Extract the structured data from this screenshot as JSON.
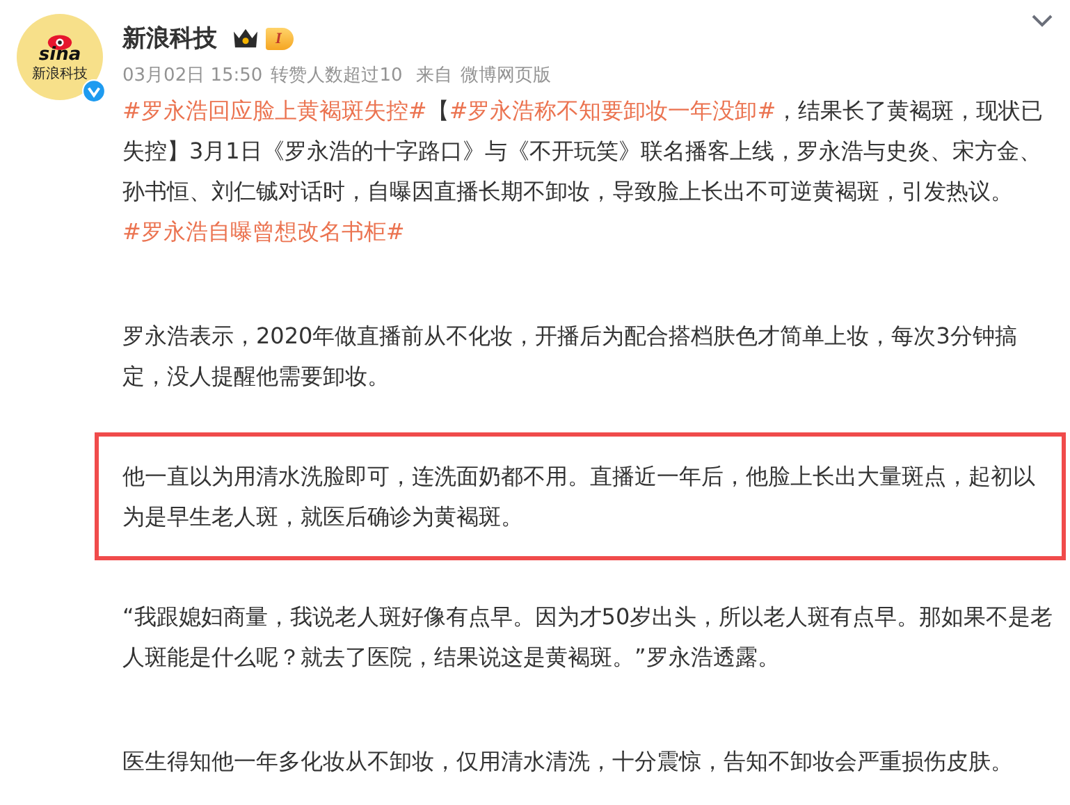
{
  "post": {
    "avatar": {
      "logo": "sina",
      "caption": "新浪科技",
      "verified": true
    },
    "author": "新浪科技",
    "level": "I",
    "meta": {
      "time": "03月02日 15:50",
      "stat": "转赞人数超过10",
      "source_label": "来自",
      "source": "微博网页版"
    },
    "paragraphs": [
      {
        "highlighted": false,
        "segments": [
          {
            "kind": "hashtag",
            "text": "#罗永浩回应脸上黄褐斑失控#"
          },
          {
            "kind": "text",
            "text": "【"
          },
          {
            "kind": "hashtag",
            "text": "#罗永浩称不知要卸妆一年没卸#"
          },
          {
            "kind": "text",
            "text": "，结果长了黄褐斑，现状已失控】3月1日《罗永浩的十字路口》与《不开玩笑》联名播客上线，罗永浩与史炎、宋方金、孙书恒、刘仁铖对话时，自曝因直播长期不卸妆，导致脸上长出不可逆黄褐斑，引发热议。"
          },
          {
            "kind": "hashtag",
            "text": "#罗永浩自曝曾想改名书柜#"
          }
        ]
      },
      {
        "highlighted": false,
        "segments": [
          {
            "kind": "text",
            "text": "罗永浩表示，2020年做直播前从不化妆，开播后为配合搭档肤色才简单上妆，每次3分钟搞定，没人提醒他需要卸妆。"
          }
        ]
      },
      {
        "highlighted": true,
        "segments": [
          {
            "kind": "text",
            "text": "他一直以为用清水洗脸即可，连洗面奶都不用。直播近一年后，他脸上长出大量斑点，起初以为是早生老人斑，就医后确诊为黄褐斑。"
          }
        ]
      },
      {
        "highlighted": false,
        "segments": [
          {
            "kind": "text",
            "text": "“我跟媳妇商量，我说老人斑好像有点早。因为才50岁出头，所以老人斑有点早。那如果不是老人斑能是什么呢？就去了医院，结果说这是黄褐斑。”罗永浩透露。"
          }
        ]
      },
      {
        "highlighted": false,
        "segments": [
          {
            "kind": "text",
            "text": "医生得知他一年多化妆从不卸妆，仅用清水清洗，十分震惊，告知不卸妆会严重损伤皮肤。"
          }
        ]
      }
    ]
  }
}
